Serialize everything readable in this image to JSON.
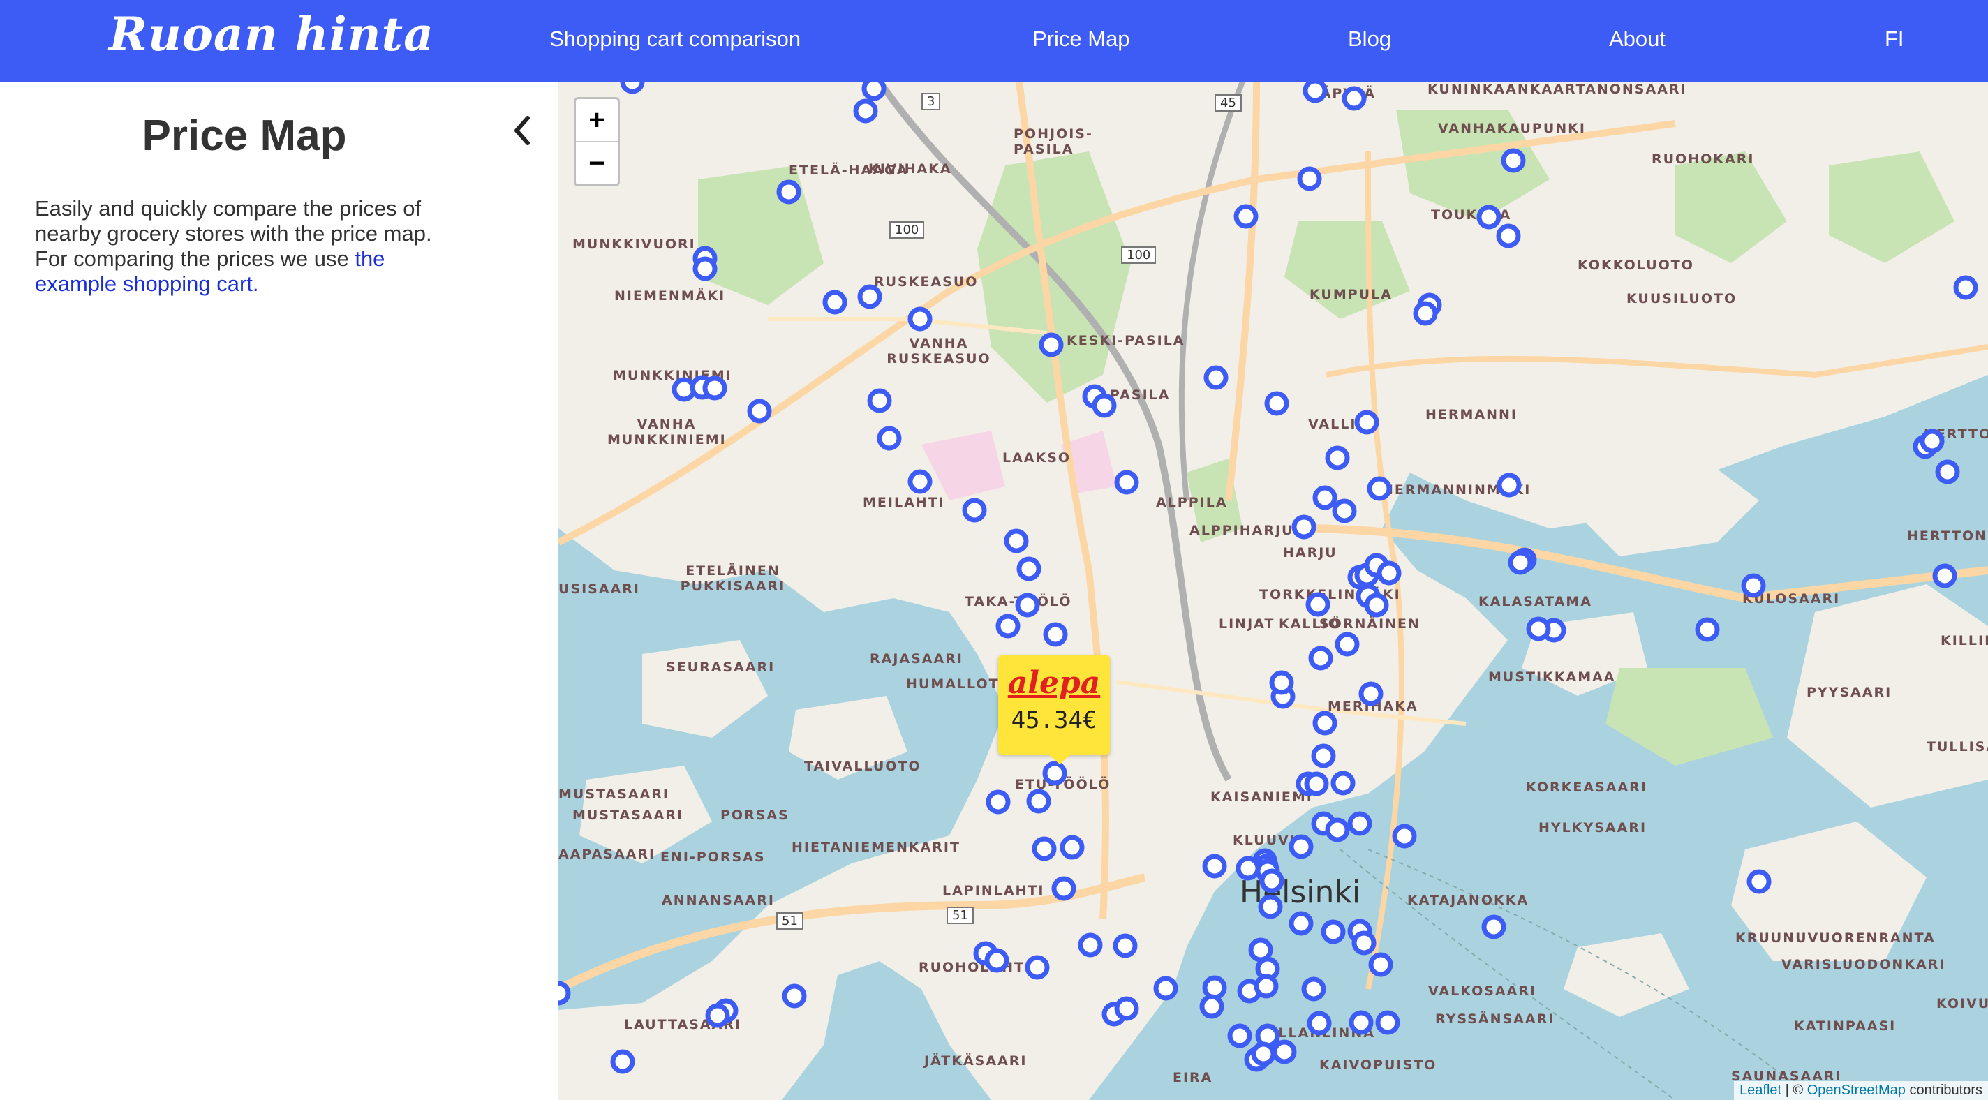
{
  "navbar": {
    "brand": "Ruoan hinta",
    "links": [
      "Shopping cart comparison",
      "Price Map",
      "Blog",
      "About",
      "FI"
    ]
  },
  "sidebar": {
    "title": "Price Map",
    "collapse_icon": "chevron-left-icon",
    "description": "Easily and quickly compare the prices of nearby grocery stores with the price map. For comparing the prices we use",
    "link_text": "the example shopping cart."
  },
  "map": {
    "zoom_in": "+",
    "zoom_out": "−",
    "popup": {
      "store": "alepa",
      "price": "45.34€"
    },
    "attribution": {
      "leaflet": "Leaflet",
      "separator": " | © ",
      "osm": "OpenStreetMap",
      "suffix": " contributors"
    },
    "labels": [
      "KÄPYLÄ",
      "KUNINKAANKAARTANONSAARI",
      "VANHAKAUPUNKI",
      "RUOHOKARI",
      "POHJOIS-PASILA",
      "ETELÄ-HAAGA",
      "KIVIHAKA",
      "MUNKKIVUORI",
      "TOUKOLA",
      "KOKKOLUOTO",
      "KUUSILUOTO",
      "NIEMENMÄKI",
      "RUSKEASUO",
      "KUMPULA",
      "VANHA RUSKEASUO",
      "KESKI-PASILA",
      "MUNKKINIEMI",
      "PASILA",
      "HERMANNI",
      "VANHA MUNKKINIEMI",
      "VALLILA",
      "LAAKSO",
      "MEILAHTI",
      "ALPPILA",
      "HERMANNINMÄKI",
      "ALPPIHARJU",
      "HARJU",
      "ETELÄINEN PUKKISAARI",
      "TAKA-TÖÖLÖ",
      "TORKKELINMÄKI",
      "KALASATAMA",
      "KULOSAARI",
      "LINJAT",
      "KALLIO",
      "SÖRNÄINEN",
      "SEURASAARI",
      "RAJASAARI",
      "HUMALLOTO",
      "MUSTIKKAMAA",
      "PYYSAARI",
      "MERIHAKA",
      "TAIVALLUOTO",
      "ETU-TÖÖLÖ",
      "KAISANIEMI",
      "KORKEASAARI",
      "MUSTASAARI",
      "PORSAS",
      "HIETANIEMENKARIT",
      "KLUUVI",
      "HYLKYSAARI",
      "ENI-PORSAS",
      "LAPINLAHTI",
      "KATAJANOKKA",
      "ANNANSAARI",
      "KRUUNUVUORENRANTA",
      "VARISLUODONKARI",
      "RUOHOLAHTI",
      "LAUTTASAARI",
      "VALKOSAARI",
      "RYSSÄNSAARI",
      "KATINPAASI",
      "JÄTKÄSAARI",
      "ULLANLINNA",
      "KAIVOPUISTO",
      "EIRA",
      "SAUNASAARI",
      "HERTTONIEMI",
      "HERTTONIEMENRANTA",
      "KILLINGE",
      "TULLISAARI",
      "USISAARI",
      "AAPASAARI",
      "MUSTASAARI",
      "KOIVUSAARI"
    ],
    "city_label": "Helsinki",
    "road_numbers": [
      "3",
      "45",
      "100",
      "100",
      "51",
      "51"
    ]
  }
}
